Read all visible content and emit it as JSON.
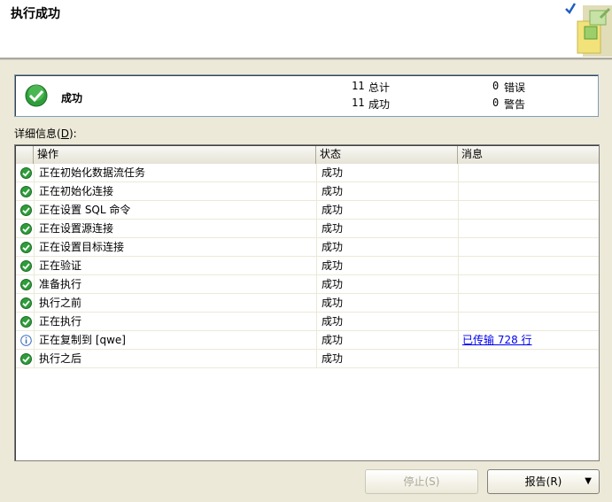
{
  "header": {
    "title": "执行成功"
  },
  "summary": {
    "status": "成功",
    "total_count": "11",
    "total_label": "总计",
    "success_count": "11",
    "success_label": "成功",
    "error_count": "0",
    "error_label": "错误",
    "warning_count": "0",
    "warning_label": "警告"
  },
  "details": {
    "label_prefix": "详细信息(",
    "label_key": "D",
    "label_suffix": "):"
  },
  "table": {
    "columns": [
      "操作",
      "状态",
      "消息"
    ],
    "rows": [
      {
        "icon": "success-icon",
        "action": "正在初始化数据流任务",
        "status": "成功",
        "message": ""
      },
      {
        "icon": "success-icon",
        "action": "正在初始化连接",
        "status": "成功",
        "message": ""
      },
      {
        "icon": "success-icon",
        "action": "正在设置 SQL 命令",
        "status": "成功",
        "message": ""
      },
      {
        "icon": "success-icon",
        "action": "正在设置源连接",
        "status": "成功",
        "message": ""
      },
      {
        "icon": "success-icon",
        "action": "正在设置目标连接",
        "status": "成功",
        "message": ""
      },
      {
        "icon": "success-icon",
        "action": "正在验证",
        "status": "成功",
        "message": ""
      },
      {
        "icon": "success-icon",
        "action": "准备执行",
        "status": "成功",
        "message": ""
      },
      {
        "icon": "success-icon",
        "action": "执行之前",
        "status": "成功",
        "message": ""
      },
      {
        "icon": "success-icon",
        "action": "正在执行",
        "status": "成功",
        "message": ""
      },
      {
        "icon": "info-icon",
        "action": "正在复制到 [qwe]",
        "status": "成功",
        "message": "已传输 728 行"
      },
      {
        "icon": "success-icon",
        "action": "执行之后",
        "status": "成功",
        "message": ""
      }
    ]
  },
  "buttons": {
    "stop": "停止(S)",
    "report": "报告(R)"
  },
  "colors": {
    "success": "#2e9e3a",
    "info": "#3a6ec0",
    "link": "#0000ee"
  }
}
